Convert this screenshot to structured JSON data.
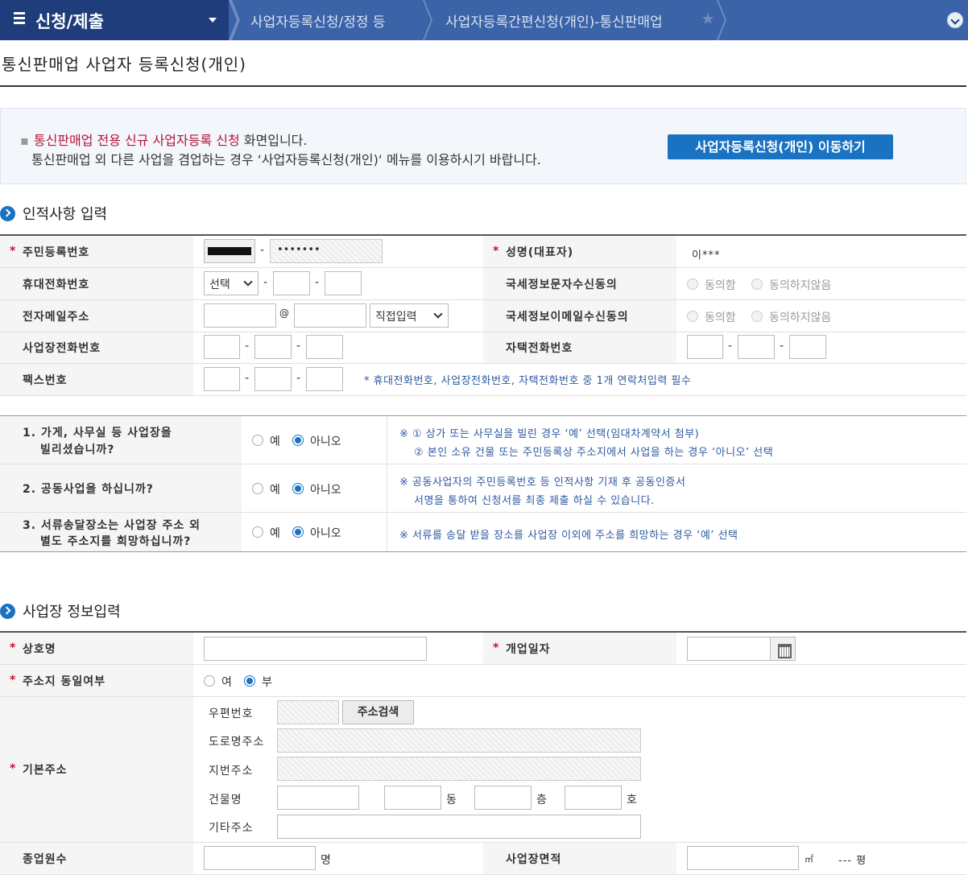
{
  "topbar": {
    "menu_title": "신청/제출",
    "crumb1": "사업자등록신청/정정 등",
    "crumb2": "사업자등록간편신청(개인)-통신판매업"
  },
  "page_title": "통신판매업 사업자 등록신청(개인)",
  "notice": {
    "highlight": "통신판매업 전용 신규 사업자등록 신청",
    "line1_rest": " 화면입니다.",
    "line2": "통신판매업 외 다른 사업을 겸업하는 경우 ‘사업자등록신청(개인)‘  메뉴를 이용하시기 바랍니다.",
    "button": "사업자등록신청(개인) 이동하기"
  },
  "personal": {
    "section_title": "인적사항 입력",
    "rrn_label": "주민등록번호",
    "rrn_back": "•••••••",
    "name_label": "성명(대표자)",
    "name_value": "이***",
    "mobile_label": "휴대전화번호",
    "mobile_select": "선택",
    "sms_label": "국세정보문자수신동의",
    "agree": "동의함",
    "disagree": "동의하지않음",
    "email_label": "전자메일주소",
    "at": "@",
    "email_select": "직접입력",
    "email_consent_label": "국세정보이메일수신동의",
    "bizphone_label": "사업장전화번호",
    "homephone_label": "자택전화번호",
    "fax_label": "팩스번호",
    "contact_note": "* 휴대전화번호, 사업장전화번호, 자택전화번호 중 1개 연락처입력 필수"
  },
  "questions": {
    "yes": "예",
    "no": "아니오",
    "q1_line1": "1. 가게, 사무실 등 사업장을",
    "q1_line2": "빌리셨습니까?",
    "q1_note1": "※ ① 상가 또는 사무실을 빌린 경우 ‘예’ 선택(임대차계약서 첨부)",
    "q1_note2": "② 본인 소유 건물 또는 주민등록상 주소지에서 사업을 하는 경우 ‘아니오’ 선택",
    "q2": "2. 공동사업을 하십니까?",
    "q2_note1": "※ 공동사업자의 주민등록번호 등 인적사항 기재 후 공동인증서",
    "q2_note2": "서명을 통하여 신청서를 최종 제출 하실 수 있습니다.",
    "q3_line1": "3. 서류송달장소는 사업장 주소 외",
    "q3_line2": "별도 주소지를 희망하십니까?",
    "q3_note": "※ 서류를 송달 받을 장소를 사업장 이외에 주소를 희망하는 경우 ‘예’ 선택"
  },
  "business": {
    "section_title": "사업장 정보입력",
    "trade_name_label": "상호명",
    "open_date_label": "개업일자",
    "same_addr_label": "주소지 동일여부",
    "same_yes": "여",
    "same_no": "부",
    "address_label": "기본주소",
    "zip_label": "우편번호",
    "zip_button": "주소검색",
    "road_label": "도로명주소",
    "lot_label": "지번주소",
    "building_label": "건물명",
    "dong": "동",
    "floor": "층",
    "ho": "호",
    "etc_label": "기타주소",
    "employees_label": "종업원수",
    "employees_unit": "명",
    "area_label": "사업장면적",
    "area_unit": "㎡",
    "area_pyeong": "--- 평"
  }
}
